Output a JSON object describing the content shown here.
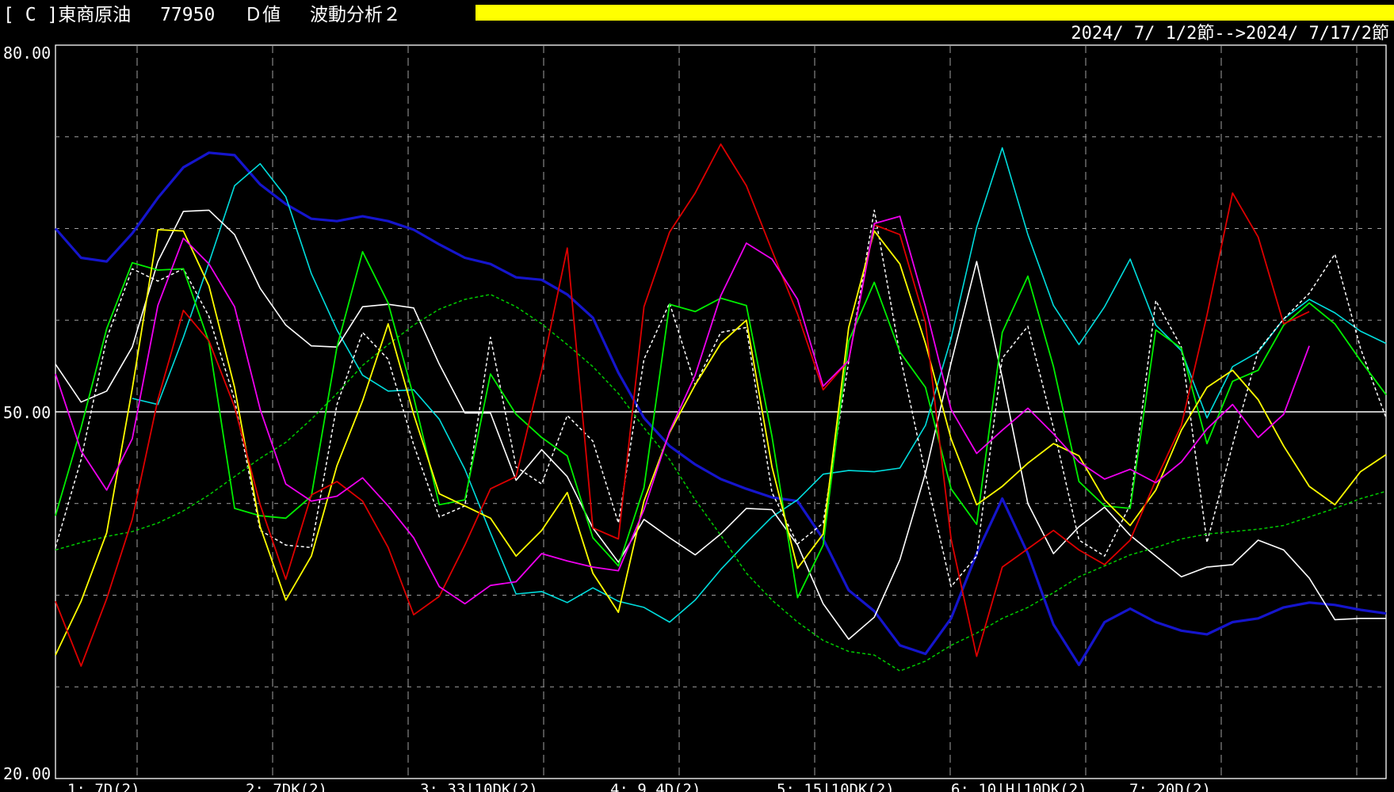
{
  "header": {
    "title": "[ C ]東商原油　 77950　 Ｄ値　 波動分析２",
    "range": "2024/ 7/ 1/2節-->2024/ 7/17/2節",
    "bar_color": "#ffff00"
  },
  "chart_data": {
    "type": "line",
    "ylim": [
      20,
      80
    ],
    "yticks": [
      "80.00",
      "50.00",
      "20.00"
    ],
    "xlabels": [
      "1: 7D(2)",
      "2: 7DK(2)",
      "3: 33|10DK(2)",
      "4: 9 4D(2)",
      "5: 15|10DK(2)",
      "6: 10|H|10DK(2)",
      "7: 20D(2)"
    ],
    "reference_line": 50,
    "series": [
      {
        "color": "#1515cc",
        "style": "solid",
        "width": 3.2,
        "values": [
          65,
          62.6,
          62.3,
          64.6,
          67.5,
          70,
          71.2,
          71,
          68.6,
          67,
          65.8,
          65.6,
          66,
          65.6,
          64.9,
          63.7,
          62.6,
          62.1,
          61,
          60.8,
          59.6,
          57.7,
          53.2,
          49.5,
          47.2,
          45.7,
          44.5,
          43.7,
          43,
          42.7,
          39.6,
          35.4,
          33.7,
          30.9,
          30.2,
          33.1,
          38.4,
          42.9,
          38.4,
          32.6,
          29.3,
          32.8,
          33.9,
          32.8,
          32.1,
          31.8,
          32.8,
          33.1,
          34,
          34.4,
          34.2,
          33.8,
          33.5
        ]
      },
      {
        "color": "#00dddd",
        "style": "solid",
        "width": 1.6,
        "values": [
          null,
          null,
          null,
          51.1,
          50.6,
          56.1,
          62.2,
          68.5,
          70.3,
          67.6,
          61.3,
          56.7,
          53,
          51.7,
          51.8,
          49.4,
          45.3,
          40.1,
          35.1,
          35.3,
          34.4,
          35.6,
          34.5,
          34,
          32.8,
          34.6,
          37.1,
          39.3,
          41.4,
          42.8,
          44.9,
          45.2,
          45.1,
          45.4,
          48.9,
          56,
          65.1,
          71.6,
          64.5,
          58.7,
          55.5,
          58.6,
          62.5,
          57.1,
          55,
          49.5,
          53.7,
          54.9,
          57.6,
          59.2,
          58.1,
          56.6,
          55.6
        ]
      },
      {
        "color": "#ffffff",
        "style": "solid",
        "width": 1.6,
        "values": [
          53.9,
          50.8,
          51.7,
          55.3,
          62.3,
          66.4,
          66.5,
          64.5,
          60.1,
          57.1,
          55.4,
          55.3,
          58.6,
          58.8,
          58.5,
          53.9,
          49.9,
          49.9,
          44.4,
          46.9,
          44.7,
          40.5,
          37.7,
          41.2,
          39.7,
          38.3,
          40,
          42.1,
          42,
          39.1,
          34.3,
          31.4,
          33.2,
          37.9,
          45,
          54,
          62.3,
          52.8,
          42.5,
          38.4,
          40.6,
          42.2,
          39.9,
          38.2,
          36.5,
          37.3,
          37.5,
          39.5,
          38.7,
          36.4,
          33,
          33.1,
          33.1
        ]
      },
      {
        "color": "#ffffff",
        "style": "dashed",
        "width": 1.5,
        "values": [
          38.9,
          46.1,
          56,
          61.7,
          60.7,
          61.7,
          57.8,
          51,
          40.3,
          39.1,
          38.9,
          50.6,
          56.5,
          54.3,
          47.3,
          41.4,
          42.3,
          56.1,
          45.5,
          44.1,
          49.7,
          47.6,
          40.9,
          54.3,
          58.9,
          52.2,
          56.5,
          56.9,
          43.4,
          39.2,
          40.9,
          54.1,
          66.5,
          54.7,
          44.9,
          35.7,
          38.2,
          54.4,
          57,
          48.7,
          39.5,
          38.2,
          42.4,
          59.1,
          55.3,
          39.3,
          47.3,
          55,
          57.6,
          59.7,
          62.9,
          55.2,
          49.5
        ]
      },
      {
        "color": "#00cc00",
        "style": "dashed",
        "width": 1.5,
        "values": [
          38.7,
          39.3,
          39.8,
          40.2,
          40.9,
          41.9,
          43.2,
          44.7,
          46.2,
          47.5,
          49.4,
          51.5,
          53.8,
          55.5,
          57.1,
          58.4,
          59.2,
          59.6,
          58.6,
          57.2,
          55.5,
          53.7,
          51.5,
          48.7,
          46.1,
          42.8,
          39.9,
          36.8,
          34.6,
          32.8,
          31.3,
          30.4,
          30.1,
          28.8,
          29.6,
          30.9,
          31.9,
          33.1,
          34,
          35.2,
          36.5,
          37.4,
          38.3,
          38.9,
          39.6,
          40,
          40.2,
          40.4,
          40.7,
          41.4,
          42.1,
          42.9,
          43.5
        ]
      },
      {
        "color": "#00ee00",
        "style": "solid",
        "width": 1.8,
        "values": [
          41.5,
          48.7,
          56.8,
          62.2,
          61.6,
          61.7,
          55.7,
          42.1,
          41.5,
          41.3,
          43.1,
          55.3,
          63.1,
          58.9,
          51.2,
          42.4,
          42.8,
          53.1,
          49.8,
          47.9,
          46.4,
          39.7,
          37.4,
          43.8,
          58.8,
          58.2,
          59.3,
          58.7,
          48,
          34.8,
          39.1,
          55.8,
          60.6,
          54.9,
          52,
          43.7,
          40.8,
          56.5,
          61.1,
          53.7,
          44.3,
          42.3,
          42.1,
          56.7,
          55.2,
          47.4,
          52.5,
          53.4,
          57.1,
          58.9,
          57.2,
          54.2,
          51.4
        ]
      },
      {
        "color": "#ffff00",
        "style": "solid",
        "width": 1.8,
        "values": [
          30.1,
          34.5,
          40.1,
          51.9,
          64.9,
          64.8,
          60.3,
          52,
          40.6,
          34.6,
          38.2,
          45.6,
          50.9,
          57.2,
          49.8,
          43.3,
          42.3,
          41.3,
          38.2,
          40.3,
          43.4,
          36.8,
          33.6,
          42.7,
          48.3,
          52.2,
          55.6,
          57.5,
          45.5,
          37.2,
          40,
          56.9,
          64.8,
          62.1,
          55.6,
          47.8,
          42.4,
          43.9,
          45.8,
          47.4,
          46.4,
          42.8,
          40.7,
          43.6,
          48.5,
          52,
          53.4,
          51,
          47.2,
          43.9,
          42.4,
          45.1,
          46.5
        ]
      },
      {
        "color": "#dd0000",
        "style": "solid",
        "width": 1.8,
        "values": [
          34.5,
          29.2,
          34.7,
          41.2,
          51,
          58.3,
          55.8,
          50.4,
          42.4,
          36.3,
          43.2,
          44.3,
          42.7,
          38.9,
          33.4,
          34.9,
          39.1,
          43.7,
          44.7,
          53.4,
          63.4,
          40.5,
          39.6,
          58.6,
          64.7,
          67.9,
          71.9,
          68.5,
          63.2,
          58,
          51.8,
          54.2,
          65.3,
          64.5,
          57.3,
          39.6,
          30,
          37.3,
          38.8,
          40.3,
          38.7,
          37.5,
          39.5,
          44.4,
          48.9,
          57.9,
          67.9,
          64.3,
          57.2,
          58.2
        ]
      },
      {
        "color": "#ee00ee",
        "style": "solid",
        "width": 1.8,
        "values": [
          53.1,
          46.8,
          43.6,
          47.8,
          58.7,
          64.2,
          62.1,
          58.6,
          50.2,
          44.1,
          42.7,
          43.1,
          44.6,
          42.3,
          39.7,
          35.7,
          34.3,
          35.8,
          36.1,
          38.4,
          37.8,
          37.3,
          37,
          42,
          48.4,
          53,
          59.5,
          63.8,
          62.5,
          59.2,
          52.1,
          54.2,
          65.4,
          66,
          58.6,
          50.2,
          46.6,
          48.5,
          50.3,
          48.2,
          45.9,
          44.5,
          45.3,
          44.2,
          45.9,
          48.6,
          50.6,
          47.9,
          49.8,
          55.4
        ]
      }
    ]
  }
}
